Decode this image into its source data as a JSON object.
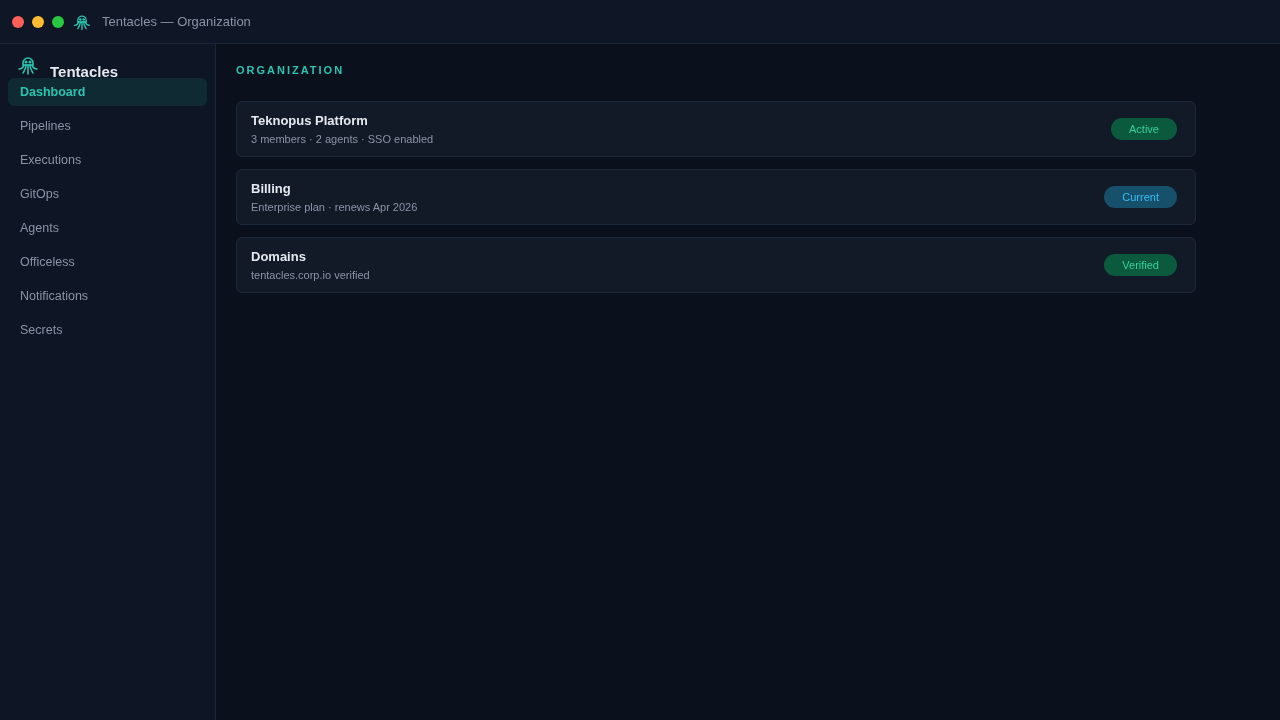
{
  "window": {
    "title": "Tentacles — Organization"
  },
  "sidebar": {
    "brand": "Tentacles",
    "items": [
      {
        "label": "Dashboard",
        "selected": true
      },
      {
        "label": "Pipelines",
        "selected": false
      },
      {
        "label": "Executions",
        "selected": false
      },
      {
        "label": "GitOps",
        "selected": false
      },
      {
        "label": "Agents",
        "selected": false
      },
      {
        "label": "Officeless",
        "selected": false
      },
      {
        "label": "Notifications",
        "selected": false
      },
      {
        "label": "Secrets",
        "selected": false
      }
    ]
  },
  "heading": "ORGANIZATION",
  "cards": [
    {
      "title": "Teknopus Platform",
      "subtitle": "3 members · 2 agents · SSO enabled",
      "badge": {
        "label": "Active",
        "kind": "success"
      }
    },
    {
      "title": "Billing",
      "subtitle": "Enterprise plan · renews Apr 2026",
      "badge": {
        "label": "Current",
        "kind": "info"
      }
    },
    {
      "title": "Domains",
      "subtitle": "tentacles.corp.io verified",
      "badge": {
        "label": "Verified",
        "kind": "success"
      }
    }
  ]
}
